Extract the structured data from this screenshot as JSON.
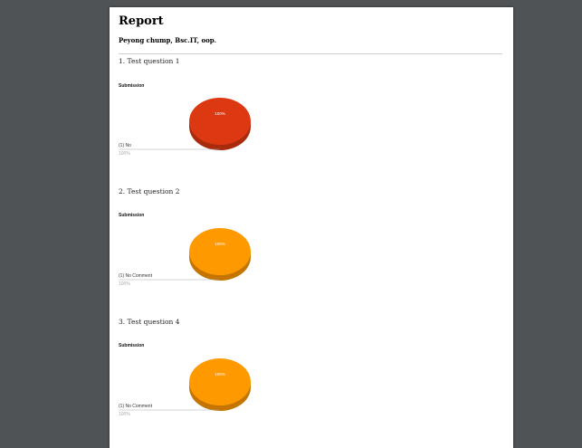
{
  "report": {
    "title": "Report",
    "subtitle": "Peyong chump, Bsc.IT, oop."
  },
  "questions": [
    {
      "label": "1. Test question 1",
      "chart_title": "Submission"
    },
    {
      "label": "2. Test question 2",
      "chart_title": "Submission"
    },
    {
      "label": "3. Test question 4",
      "chart_title": "Submission"
    }
  ],
  "chart_data": [
    {
      "type": "pie",
      "title": "Submission",
      "categories": [
        "(1) No"
      ],
      "values": [
        1
      ],
      "percent_labels": [
        "100%"
      ],
      "slice_label": "100%",
      "colors": {
        "top": "#dc3912",
        "side": "#a92b0e"
      }
    },
    {
      "type": "pie",
      "title": "Submission",
      "categories": [
        "(1) No Comment"
      ],
      "values": [
        1
      ],
      "percent_labels": [
        "100%"
      ],
      "slice_label": "100%",
      "colors": {
        "top": "#ff9900",
        "side": "#c47500"
      }
    },
    {
      "type": "pie",
      "title": "Submission",
      "categories": [
        "(1) No Comment"
      ],
      "values": [
        1
      ],
      "percent_labels": [
        "100%"
      ],
      "slice_label": "100%",
      "colors": {
        "top": "#ff9900",
        "side": "#c47500"
      }
    }
  ]
}
